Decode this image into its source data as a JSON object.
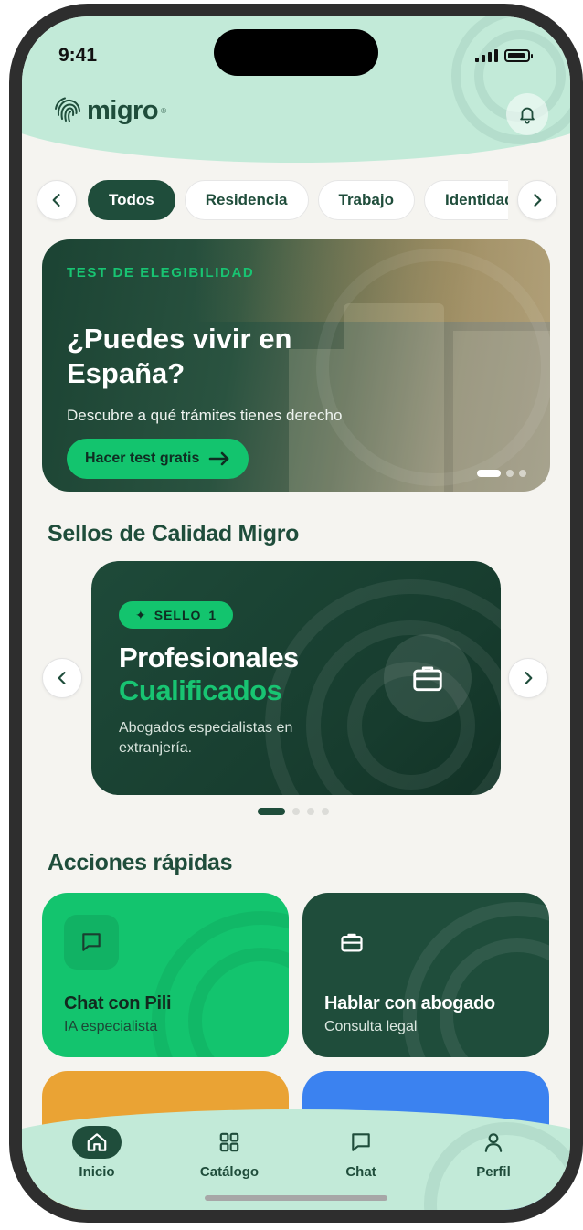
{
  "status_bar": {
    "time": "9:41"
  },
  "brand": {
    "logo_text": "migro",
    "registered": "®"
  },
  "categories": {
    "items": [
      {
        "label": "Todos",
        "active": true
      },
      {
        "label": "Residencia",
        "active": false
      },
      {
        "label": "Trabajo",
        "active": false
      },
      {
        "label": "Identidad",
        "active": false
      }
    ]
  },
  "hero": {
    "kicker": "TEST DE ELEGIBILIDAD",
    "title": "¿Puedes vivir en España?",
    "subtitle": "Descubre a qué trámites tienes derecho",
    "cta_label": "Hacer test gratis"
  },
  "seals": {
    "section_title": "Sellos de Calidad Migro",
    "badge_label": "SELLO",
    "badge_number": "1",
    "title_line1": "Profesionales",
    "title_line2": "Cualificados",
    "description": "Abogados especialistas en extranjería."
  },
  "quick_actions": {
    "section_title": "Acciones rápidas",
    "items": [
      {
        "title": "Chat con Pili",
        "subtitle": "IA especialista",
        "icon": "chat-bubble-icon",
        "color": "#13c46e"
      },
      {
        "title": "Hablar con abogado",
        "subtitle": "Consulta legal",
        "icon": "briefcase-icon",
        "color": "#1f4d3b"
      },
      {
        "title": "",
        "subtitle": "",
        "icon": "",
        "color": "#eaa334"
      },
      {
        "title": "",
        "subtitle": "",
        "icon": "",
        "color": "#3b82f0"
      }
    ]
  },
  "tabbar": {
    "items": [
      {
        "label": "Inicio",
        "icon": "home-icon",
        "active": true
      },
      {
        "label": "Catálogo",
        "icon": "grid-icon",
        "active": false
      },
      {
        "label": "Chat",
        "icon": "chat-bubble-icon",
        "active": false
      },
      {
        "label": "Perfil",
        "icon": "user-icon",
        "active": false
      }
    ]
  },
  "colors": {
    "brand_dark": "#1f4d3b",
    "brand_green": "#13c46e",
    "mint": "#c2ead8",
    "background": "#f5f4f0"
  }
}
